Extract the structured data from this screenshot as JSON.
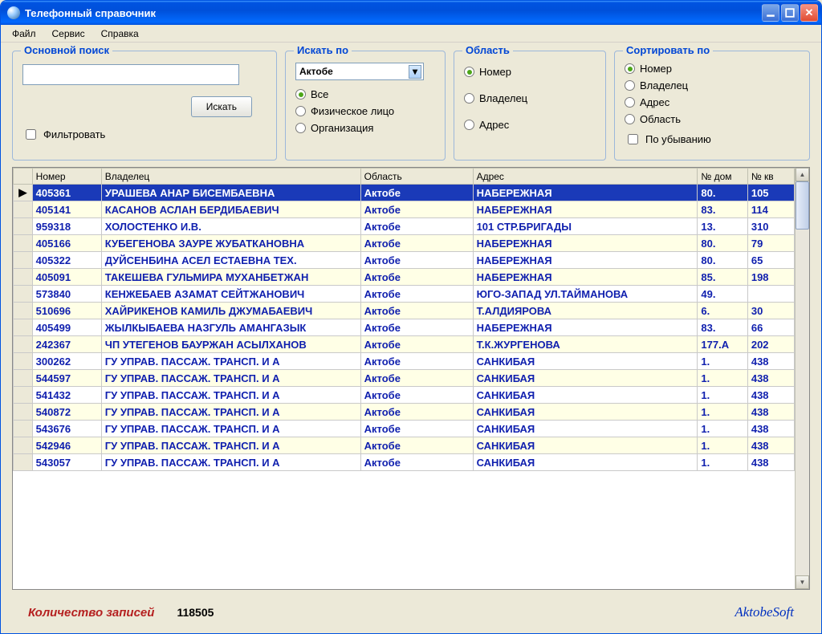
{
  "window": {
    "title": "Телефонный справочник"
  },
  "menu": {
    "file": "Файл",
    "service": "Сервис",
    "help": "Справка"
  },
  "search_panel": {
    "title": "Основной поиск",
    "button": "Искать",
    "filter_label": "Фильтровать"
  },
  "by_panel": {
    "title": "Искать по",
    "combo_value": "Актобе",
    "opt_all": "Все",
    "opt_person": "Физическое лицо",
    "opt_org": "Организация"
  },
  "oblast_panel": {
    "title": "Область",
    "opt_number": "Номер",
    "opt_owner": "Владелец",
    "opt_address": "Адрес"
  },
  "sort_panel": {
    "title": "Сортировать по",
    "opt_number": "Номер",
    "opt_owner": "Владелец",
    "opt_address": "Адрес",
    "opt_oblast": "Область",
    "desc_label": "По убыванию"
  },
  "grid": {
    "headers": {
      "number": "Номер",
      "owner": "Владелец",
      "oblast": "Область",
      "address": "Адрес",
      "house": "№ дом",
      "apt": "№ кв"
    },
    "rows": [
      {
        "num": "405361",
        "owner": "УРАШЕВА АНАР БИСЕМБАЕВНА",
        "oblast": "Актобе",
        "addr": "НАБЕРЕЖНАЯ",
        "house": "80.",
        "apt": "105"
      },
      {
        "num": "405141",
        "owner": "КАСАНОВ АСЛАН БЕРДИБАЕВИЧ",
        "oblast": "Актобе",
        "addr": "НАБЕРЕЖНАЯ",
        "house": "83.",
        "apt": "114"
      },
      {
        "num": "959318",
        "owner": "ХОЛОСТЕНКО И.В.",
        "oblast": "Актобе",
        "addr": "101 СТР.БРИГАДЫ",
        "house": "13.",
        "apt": "310"
      },
      {
        "num": "405166",
        "owner": "КУБЕГЕНОВА ЗАУРЕ ЖУБАТКАНОВНА",
        "oblast": "Актобе",
        "addr": "НАБЕРЕЖНАЯ",
        "house": "80.",
        "apt": "79"
      },
      {
        "num": "405322",
        "owner": "ДУЙСЕНБИНА АСЕЛ ЕСТАЕВНА ТЕХ.",
        "oblast": "Актобе",
        "addr": "НАБЕРЕЖНАЯ",
        "house": "80.",
        "apt": "65"
      },
      {
        "num": "405091",
        "owner": "ТАКЕШЕВА ГУЛЬМИРА МУХАНБЕТЖАН",
        "oblast": "Актобе",
        "addr": "НАБЕРЕЖНАЯ",
        "house": "85.",
        "apt": "198"
      },
      {
        "num": "573840",
        "owner": "КЕНЖЕБАЕВ АЗАМАТ СЕЙТЖАНОВИЧ",
        "oblast": "Актобе",
        "addr": "ЮГО-ЗАПАД УЛ.ТАЙМАНОВА",
        "house": "49.",
        "apt": ""
      },
      {
        "num": "510696",
        "owner": "ХАЙРИКЕНОВ КАМИЛЬ ДЖУМАБАЕВИЧ",
        "oblast": "Актобе",
        "addr": "Т.АЛДИЯРОВА",
        "house": "6.",
        "apt": "30"
      },
      {
        "num": "405499",
        "owner": "ЖЫЛКЫБАЕВА НАЗГУЛЬ АМАНГАЗЫК",
        "oblast": "Актобе",
        "addr": "НАБЕРЕЖНАЯ",
        "house": "83.",
        "apt": "66"
      },
      {
        "num": "242367",
        "owner": "ЧП УТЕГЕНОВ БАУРЖАН АСЫЛХАНОВ",
        "oblast": "Актобе",
        "addr": "Т.К.ЖУРГЕНОВА",
        "house": "177.А",
        "apt": "202"
      },
      {
        "num": "300262",
        "owner": "ГУ  УПРАВ. ПАССАЖ. ТРАНСП. И А",
        "oblast": "Актобе",
        "addr": "САНКИБАЯ",
        "house": "1.",
        "apt": "438"
      },
      {
        "num": "544597",
        "owner": "ГУ  УПРАВ. ПАССАЖ. ТРАНСП. И А",
        "oblast": "Актобе",
        "addr": "САНКИБАЯ",
        "house": "1.",
        "apt": "438"
      },
      {
        "num": "541432",
        "owner": "ГУ  УПРАВ. ПАССАЖ. ТРАНСП. И А",
        "oblast": "Актобе",
        "addr": "САНКИБАЯ",
        "house": "1.",
        "apt": "438"
      },
      {
        "num": "540872",
        "owner": "ГУ  УПРАВ. ПАССАЖ. ТРАНСП. И А",
        "oblast": "Актобе",
        "addr": "САНКИБАЯ",
        "house": "1.",
        "apt": "438"
      },
      {
        "num": "543676",
        "owner": "ГУ  УПРАВ. ПАССАЖ. ТРАНСП. И А",
        "oblast": "Актобе",
        "addr": "САНКИБАЯ",
        "house": "1.",
        "apt": "438"
      },
      {
        "num": "542946",
        "owner": "ГУ  УПРАВ. ПАССАЖ. ТРАНСП. И А",
        "oblast": "Актобе",
        "addr": "САНКИБАЯ",
        "house": "1.",
        "apt": "438"
      },
      {
        "num": "543057",
        "owner": "ГУ  УПРАВ. ПАССАЖ. ТРАНСП. И А",
        "oblast": "Актобе",
        "addr": "САНКИБАЯ",
        "house": "1.",
        "apt": "438"
      }
    ]
  },
  "footer": {
    "count_label": "Количество записей",
    "count_value": "118505",
    "brand": "AktobeSoft"
  }
}
